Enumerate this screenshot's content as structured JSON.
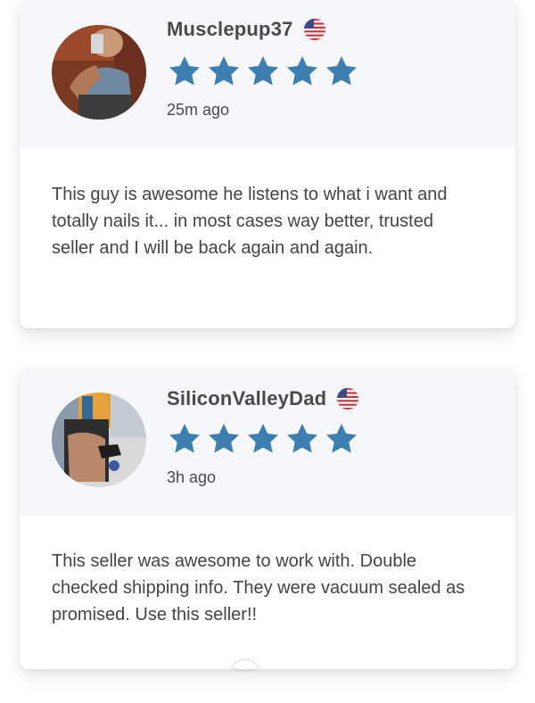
{
  "reviews": [
    {
      "username": "Musclepup37",
      "country_flag": "us-flag-icon",
      "rating": 5,
      "rating_max": 5,
      "time_ago": "25m ago",
      "text": "This guy is awesome he listens to what i want and totally nails it... in most cases way better, trusted seller and I will be back again and again."
    },
    {
      "username": "SiliconValleyDad",
      "country_flag": "us-flag-icon",
      "rating": 5,
      "rating_max": 5,
      "time_ago": "3h ago",
      "text": "This seller was awesome to work with. Double checked shipping info. They were vacuum sealed as promised. Use this seller!!"
    }
  ],
  "colors": {
    "star": "#3e7fb1",
    "header_bg": "#f5f7fa",
    "card_bg": "#ffffff",
    "text": "#444444"
  }
}
